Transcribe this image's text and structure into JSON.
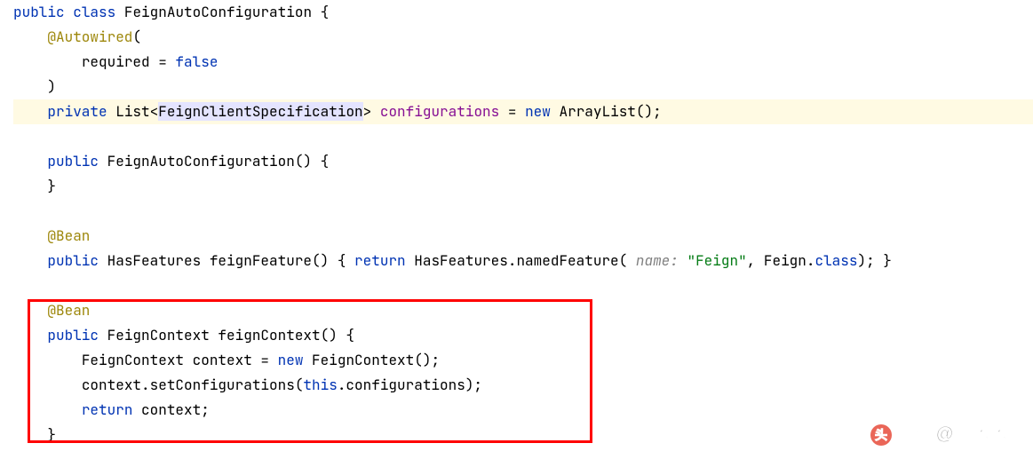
{
  "code": {
    "line1": {
      "kw_public": "public",
      "kw_class": "class",
      "classname": "FeignAutoConfiguration",
      "brace": " {"
    },
    "line2": {
      "annotation": "@Autowired",
      "paren": "("
    },
    "line3": {
      "param": "required = ",
      "value": "false"
    },
    "line4": {
      "paren": ")"
    },
    "line5": {
      "kw_private": "private",
      "type_list": "List",
      "lt": "<",
      "type_spec_pre": "FeignClientSpecif",
      "type_spec_post": "ication",
      "gt": ">",
      "field": " configurations",
      "eq": " = ",
      "kw_new": "new",
      "ctor": " ArrayList();"
    },
    "line7": {
      "kw_public": "public",
      "ctor_name": " FeignAutoConfiguration() {"
    },
    "line8": {
      "brace": "}"
    },
    "line10": {
      "annotation": "@Bean"
    },
    "line11": {
      "kw_public": "public",
      "ret_type": " HasFeatures ",
      "method": "feignFeature",
      "sig": "() { ",
      "kw_return": "return",
      "call1": " HasFeatures.namedFeature(",
      "hint": " name: ",
      "str": "\"Feign\"",
      "call2": ", Feign.",
      "kw_class": "class",
      "call3": "); }"
    },
    "line13": {
      "annotation": "@Bean"
    },
    "line14": {
      "kw_public": "public",
      "ret_type": " FeignContext ",
      "method": "feignContext",
      "sig": "() {"
    },
    "line15": {
      "type": "FeignContext ",
      "var": "context = ",
      "kw_new": "new",
      "ctor": " FeignContext();"
    },
    "line16": {
      "obj": "context.setConfigurations(",
      "kw_this": "this",
      "rest": ".configurations);"
    },
    "line17": {
      "kw_return": "return",
      "rest": " context;"
    },
    "line18": {
      "brace": "}"
    }
  },
  "watermark": {
    "text": "头条 @宇木木兮"
  }
}
